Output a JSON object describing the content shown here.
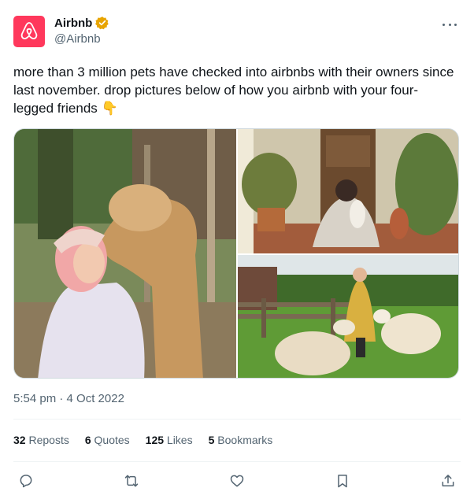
{
  "author": {
    "name": "Airbnb",
    "handle": "@Airbnb",
    "verified": true,
    "avatar_color": "#ff385c",
    "badge_color": "#e8a400"
  },
  "tweet": {
    "text": "more than 3 million pets have checked into airbnbs with their owners since last november. drop pictures below of how you airbnb with your four-legged friends 👇",
    "timestamp": "5:54 pm · 4 Oct 2022"
  },
  "media": {
    "photos": [
      {
        "icon": "photo-woman-kissing-alpaca"
      },
      {
        "icon": "photo-woman-with-dog-on-porch"
      },
      {
        "icon": "photo-woman-with-sheep-in-field"
      }
    ]
  },
  "stats": {
    "reposts_count": "32",
    "reposts_label": "Reposts",
    "quotes_count": "6",
    "quotes_label": "Quotes",
    "likes_count": "125",
    "likes_label": "Likes",
    "bookmarks_count": "5",
    "bookmarks_label": "Bookmarks"
  },
  "actions": [
    "reply-icon",
    "repost-icon",
    "like-icon",
    "bookmark-icon",
    "share-icon"
  ],
  "colors": {
    "text_primary": "#0f1419",
    "text_secondary": "#536471",
    "divider": "#eff3f4"
  }
}
